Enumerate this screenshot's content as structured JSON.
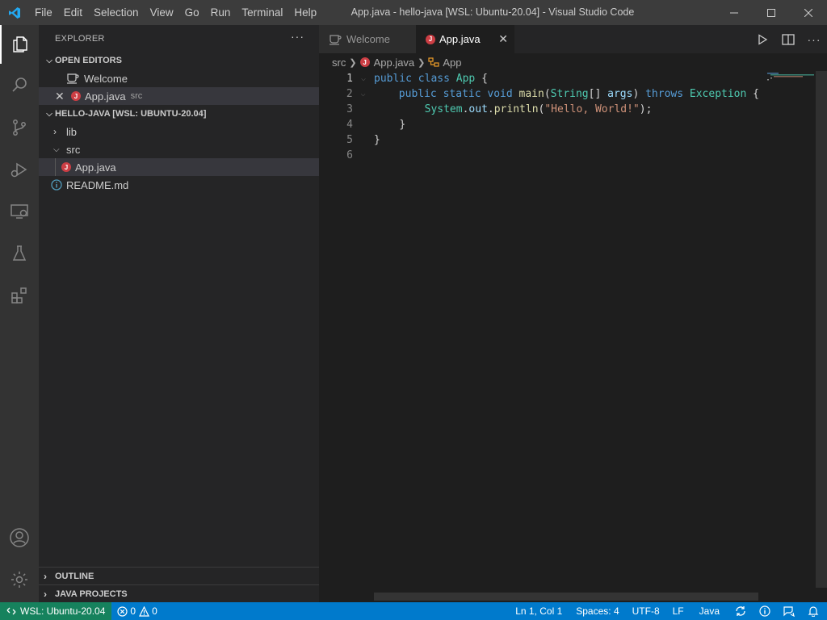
{
  "titlebar": {
    "menu": [
      "File",
      "Edit",
      "Selection",
      "View",
      "Go",
      "Run",
      "Terminal",
      "Help"
    ],
    "title": "App.java - hello-java [WSL: Ubuntu-20.04] - Visual Studio Code"
  },
  "sidebar": {
    "header": "EXPLORER",
    "more": "···",
    "open_editors_title": "OPEN EDITORS",
    "open_editors": [
      {
        "label": "Welcome",
        "hint": ""
      },
      {
        "label": "App.java",
        "hint": "src"
      }
    ],
    "workspace_title": "HELLO-JAVA [WSL: UBUNTU-20.04]",
    "tree": [
      {
        "label": "lib"
      },
      {
        "label": "src"
      },
      {
        "label": "App.java"
      },
      {
        "label": "README.md"
      }
    ],
    "outline_title": "OUTLINE",
    "java_projects_title": "JAVA PROJECTS"
  },
  "editor": {
    "tabs": [
      {
        "label": "Welcome",
        "active": false
      },
      {
        "label": "App.java",
        "active": true
      }
    ],
    "breadcrumb": [
      "src",
      "App.java",
      "App"
    ],
    "line_numbers": [
      "1",
      "2",
      "3",
      "4",
      "5",
      "6"
    ],
    "code": {
      "l1": {
        "kw1": "public",
        "kw2": "class",
        "ty": "App",
        "tx": " {"
      },
      "l2": {
        "kw1": "public",
        "kw2": "static",
        "kw3": "void",
        "fn": "main",
        "tx1": "(",
        "ty1": "String",
        "tx2": "[] ",
        "vr": "args",
        "tx3": ") ",
        "kw4": "throws",
        "ty2": "Exception",
        "tx4": " {"
      },
      "l3": {
        "ty": "System",
        "tx1": ".",
        "vr": "out",
        "tx2": ".",
        "fn": "println",
        "tx3": "(",
        "st": "\"Hello, World!\"",
        "tx4": ");"
      },
      "l4": {
        "tx": "}"
      },
      "l5": {
        "tx": "}"
      }
    }
  },
  "statusbar": {
    "remote": "WSL: Ubuntu-20.04",
    "errors": "0",
    "warnings": "0",
    "position": "Ln 1, Col 1",
    "spaces": "Spaces: 4",
    "encoding": "UTF-8",
    "eol": "LF",
    "language": "Java"
  },
  "colors": {
    "accent": "#007acc",
    "remote": "#16825d",
    "java_icon": "#cc3e44"
  }
}
